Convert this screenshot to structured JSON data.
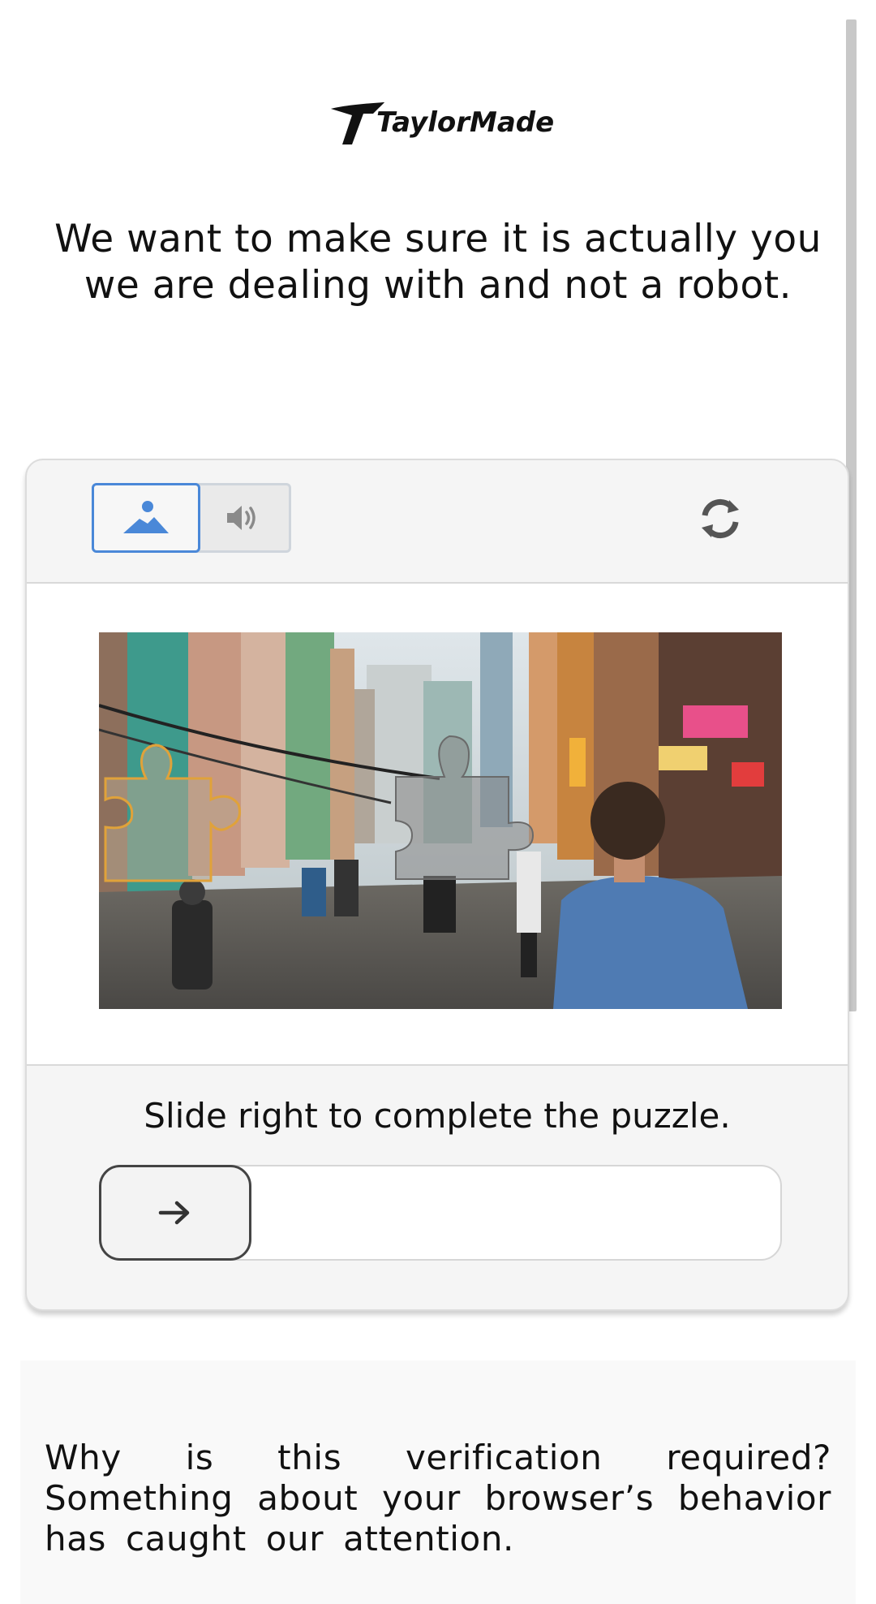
{
  "brand": {
    "logo_text": "TaylorMade"
  },
  "headline": "We want to make sure it is actually you we are dealing with and not a robot.",
  "captcha": {
    "modes": [
      {
        "name": "image",
        "icon": "landscape-icon",
        "selected": true
      },
      {
        "name": "audio",
        "icon": "speaker-icon",
        "selected": false
      }
    ],
    "refresh_icon": "refresh-icon",
    "puzzle_image": "city-street-scene",
    "instruction": "Slide right to complete the puzzle.",
    "slider": {
      "icon": "arrow-right-icon",
      "progress": 0
    }
  },
  "info": {
    "text": "Why is this verification required? Something about your browser’s behavior has caught our attention."
  },
  "colors": {
    "accent": "#4a88d8",
    "piece_outline": "#e0a23a",
    "panel_bg": "#f5f5f5",
    "border": "#d9d9d9"
  }
}
